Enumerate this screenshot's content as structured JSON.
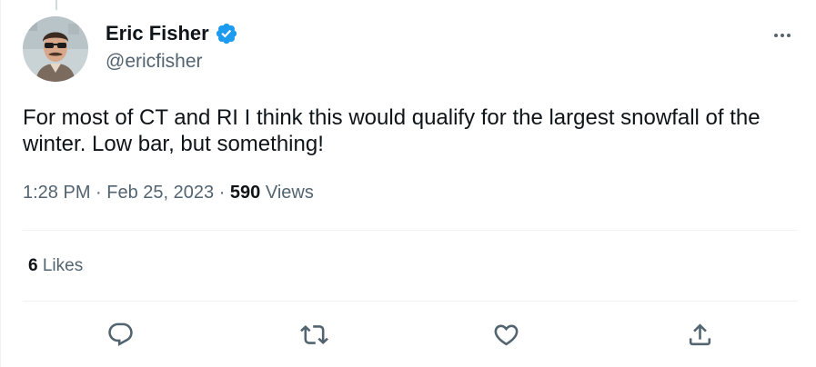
{
  "author": {
    "name": "Eric Fisher",
    "handle": "@ericfisher",
    "verified": true,
    "avatar_icon": "profile-photo-icon"
  },
  "tweet": {
    "text": "For most of CT and RI I think this would qualify for the largest snowfall of the winter. Low bar, but something!",
    "time": "1:28 PM",
    "date": "Feb 25, 2023",
    "views_count": "590",
    "views_label": "Views"
  },
  "engagement": {
    "likes_count": "6",
    "likes_label": "Likes"
  },
  "actions": [
    "reply-icon",
    "retweet-icon",
    "like-icon",
    "share-icon"
  ],
  "colors": {
    "verified_blue": "#1d9bf0",
    "text_primary": "#0f1419",
    "text_secondary": "#536471",
    "divider": "#eff3f4"
  }
}
